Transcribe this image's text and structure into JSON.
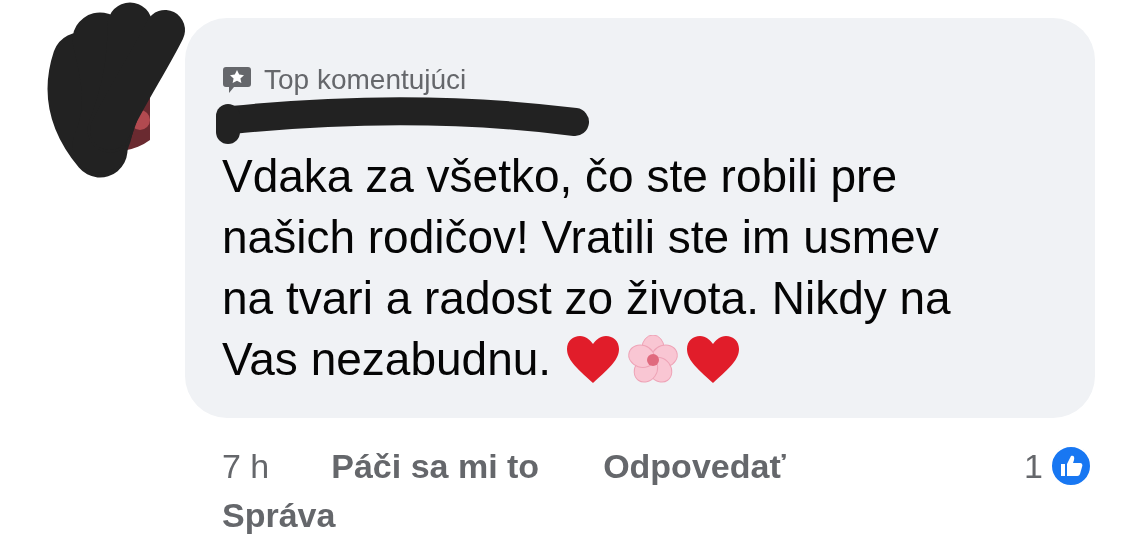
{
  "comment": {
    "badge": "Top komentujúci",
    "text_lines": [
      "Vdaka za všetko, čo ste robili pre",
      "našich rodičov! Vratili ste im usmev",
      "na tvari a radost zo života. Nikdy na",
      "Vas nezabudnu."
    ],
    "emojis": [
      {
        "kind": "heart"
      },
      {
        "kind": "flower"
      },
      {
        "kind": "heart"
      }
    ]
  },
  "footer": {
    "time": "7 h",
    "like": "Páči sa mi to",
    "reply": "Odpovedať",
    "reaction_count": "1"
  },
  "next_label": "Správa"
}
